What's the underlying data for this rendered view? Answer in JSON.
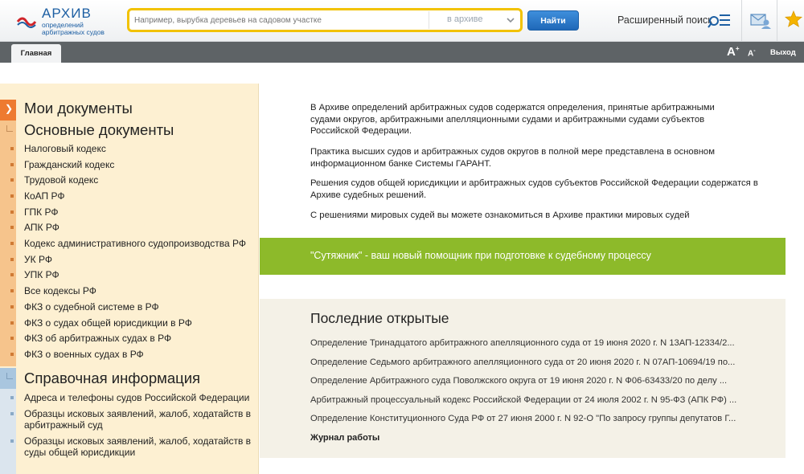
{
  "header": {
    "logo_title": "АРХИВ",
    "logo_subtitle_1": "определений",
    "logo_subtitle_2": "арбитражных судов",
    "search_placeholder": "Например, вырубка деревьев на садовом участке",
    "search_scope": "в архиве",
    "find_button": "Найти",
    "advanced_search": "Расширенный поиск"
  },
  "tabbar": {
    "home_tab": "Главная",
    "font_increase": "A",
    "font_increase_sign": "+",
    "font_decrease": "A",
    "font_decrease_sign": "-",
    "exit": "Выход"
  },
  "sidebar": {
    "my_documents": "Мои документы",
    "main_documents": "Основные документы",
    "main_items": [
      "Налоговый кодекс",
      "Гражданский кодекс",
      "Трудовой кодекс",
      "КоАП РФ",
      "ГПК РФ",
      "АПК РФ",
      "Кодекс административного судопроизводства РФ",
      "УК РФ",
      "УПК РФ",
      "Все кодексы РФ",
      "ФКЗ о судебной системе в РФ",
      "ФКЗ о судах общей юрисдикции в РФ",
      "ФКЗ об арбитражных судах в РФ",
      "ФКЗ о военных судах в РФ"
    ],
    "reference_info": "Справочная информация",
    "reference_items": [
      "Адреса и телефоны судов Российской Федерации",
      "Образцы исковых заявлений, жалоб, ходатайств в",
      "арбитражный суд",
      "Образцы исковых заявлений, жалоб, ходатайств в",
      "суды общей юрисдикции"
    ]
  },
  "main": {
    "intro": [
      "В Архиве определений арбитражных судов содержатся определения, принятые арбитражными",
      "судами округов, арбитражными апелляционными судами и арбитражными судами субъектов",
      "Российской Федерации.",
      "Практика высших судов и арбитражных судов округов в полной мере представлена в основном",
      "информационном банке Системы ГАРАНТ.",
      "Решения судов общей юрисдикции и арбитражных судов субъектов Российской Федерации содержатся в",
      "Архиве судебных решений.",
      "С решениями мировых судей вы можете ознакомиться в Архиве практики мировых судей"
    ],
    "banner": "\"Сутяжник\" - ваш новый помощник при подготовке к судебному процессу",
    "recent_title": "Последние открытые",
    "recent_items": [
      "Определение Тринадцатого арбитражного апелляционного суда от 19 июня 2020 г. N 13АП-12334/2...",
      "Определение Седьмого арбитражного апелляционного суда от 20 июня 2020 г. N 07АП-10694/19 по...",
      "Определение Арбитражного суда Поволжского округа от 19 июня 2020 г. N Ф06-63433/20 по делу ...",
      "Арбитражный процессуальный кодекс Российской Федерации от 24 июля 2002 г. N 95-ФЗ (АПК РФ) ...",
      "Определение Конституционного Суда РФ от 27 июня 2000 г. N 92-О \"По запросу группы депутатов Г..."
    ],
    "journal": "Журнал работы"
  },
  "colors": {
    "accent_blue": "#1d5fa3",
    "search_border": "#f2c200",
    "banner_green": "#8dba2a",
    "sidebar_bg": "#fdf0d2",
    "tabbar_bg": "#5e6366"
  }
}
